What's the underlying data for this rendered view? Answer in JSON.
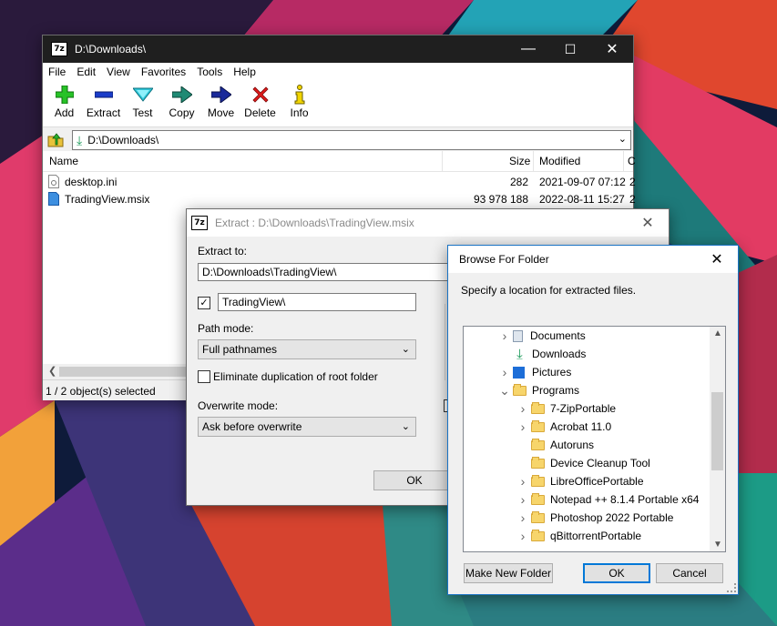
{
  "colors": {
    "title_dark": "#1f1f1f",
    "accent": "#0078d7",
    "folder": "#f7d56b"
  },
  "main_window": {
    "title": "D:\\Downloads\\",
    "menu": [
      "File",
      "Edit",
      "View",
      "Favorites",
      "Tools",
      "Help"
    ],
    "toolbar": [
      {
        "label": "Add",
        "icon": "plus-icon"
      },
      {
        "label": "Extract",
        "icon": "minus-icon"
      },
      {
        "label": "Test",
        "icon": "check-icon"
      },
      {
        "label": "Copy",
        "icon": "copy-arrow-icon"
      },
      {
        "label": "Move",
        "icon": "move-arrow-icon"
      },
      {
        "label": "Delete",
        "icon": "delete-x-icon"
      },
      {
        "label": "Info",
        "icon": "info-icon"
      }
    ],
    "address": "D:\\Downloads\\",
    "columns": {
      "name": "Name",
      "size": "Size",
      "modified": "Modified",
      "extra": "C"
    },
    "files": [
      {
        "name": "desktop.ini",
        "size": "282",
        "modified": "2021-09-07 07:12",
        "extra": "2"
      },
      {
        "name": "TradingView.msix",
        "size": "93 978 188",
        "modified": "2022-08-11 15:27",
        "extra": "2"
      }
    ],
    "status": "1 / 2 object(s) selected"
  },
  "extract_dialog": {
    "title": "Extract : D:\\Downloads\\TradingView.msix",
    "extract_to_label": "Extract to:",
    "extract_to_value": "D:\\Downloads\\TradingView\\",
    "subfolder_value": "TradingView\\",
    "path_mode_label": "Path mode:",
    "path_mode_value": "Full pathnames",
    "eliminate_label": "Eliminate duplication of root folder",
    "overwrite_label": "Overwrite mode:",
    "overwrite_value": "Ask before overwrite",
    "ok_label": "OK"
  },
  "browse_dialog": {
    "title": "Browse For Folder",
    "prompt": "Specify a location for extracted files.",
    "tree": [
      {
        "label": "Documents",
        "twisty": ">",
        "icon": "documents-icon",
        "level": 0
      },
      {
        "label": "Downloads",
        "twisty": "",
        "icon": "downloads-icon",
        "level": 0
      },
      {
        "label": "Pictures",
        "twisty": ">",
        "icon": "pictures-icon",
        "level": 0
      },
      {
        "label": "Programs",
        "twisty": "v",
        "icon": "folder-icon",
        "level": 0
      },
      {
        "label": "7-ZipPortable",
        "twisty": ">",
        "icon": "folder-icon",
        "level": 1
      },
      {
        "label": "Acrobat 11.0",
        "twisty": ">",
        "icon": "folder-icon",
        "level": 1
      },
      {
        "label": "Autoruns",
        "twisty": "",
        "icon": "folder-icon",
        "level": 1
      },
      {
        "label": "Device Cleanup Tool",
        "twisty": "",
        "icon": "folder-icon",
        "level": 1
      },
      {
        "label": "LibreOfficePortable",
        "twisty": ">",
        "icon": "folder-icon",
        "level": 1
      },
      {
        "label": "Notepad ++ 8.1.4 Portable x64",
        "twisty": ">",
        "icon": "folder-icon",
        "level": 1
      },
      {
        "label": "Photoshop 2022 Portable",
        "twisty": ">",
        "icon": "folder-icon",
        "level": 1
      },
      {
        "label": "qBittorrentPortable",
        "twisty": ">",
        "icon": "folder-icon",
        "level": 1
      }
    ],
    "make_new_folder_label": "Make New Folder",
    "ok_label": "OK",
    "cancel_label": "Cancel"
  }
}
